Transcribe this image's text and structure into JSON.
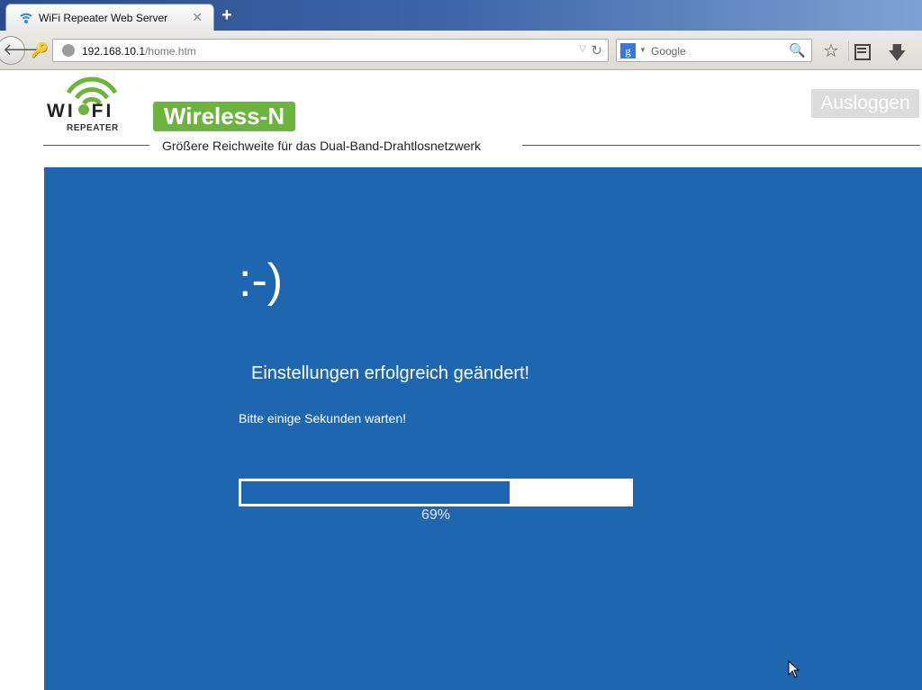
{
  "browser": {
    "tab": {
      "title": "WiFi Repeater Web Server",
      "favicon": "wifi-icon"
    },
    "new_tab_label": "+",
    "url": {
      "host": "192.168.10.1",
      "path": "/home.htm"
    },
    "search": {
      "engine": "Google",
      "placeholder": "Google"
    },
    "icons": {
      "back": "back-arrow-icon",
      "identity": "key-icon",
      "reload": "reload-icon",
      "bookmark": "star-icon",
      "bookmarks_list": "clipboard-icon",
      "downloads": "download-arrow-icon"
    }
  },
  "header": {
    "logo": {
      "wifi_left": "WI",
      "wifi_right": "FI",
      "subtitle": "REPEATER"
    },
    "badge": "Wireless-N",
    "tagline": "Größere Reichweite für das Dual-Band-Drahtlosnetzwerk",
    "logout_label": "Ausloggen"
  },
  "status": {
    "emoticon": ":-)",
    "message": "Einstellungen erfolgreich geändert!",
    "wait_message": "Bitte einige Sekunden warten!",
    "progress_percent": 69,
    "progress_label": "69%"
  },
  "colors": {
    "panel_bg": "#1f66b0",
    "brand_green": "#6db33f",
    "logout_bg": "#dcdcdc"
  }
}
